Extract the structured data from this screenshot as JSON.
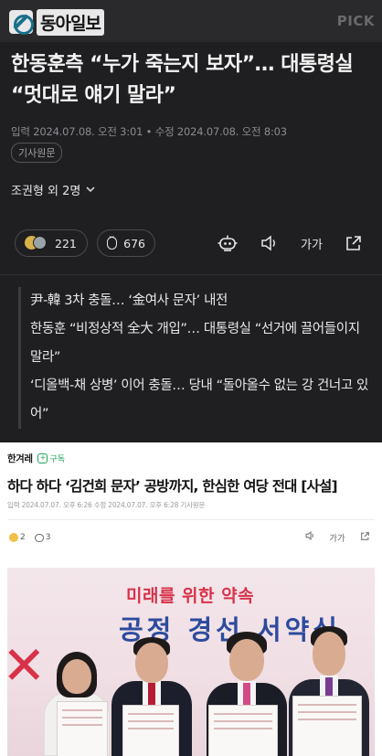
{
  "dark_card": {
    "logo_text": "동아일보",
    "pick_label": "PICK",
    "headline": "한동훈측 “누가 죽는지 보자”… 대통령실 “멋대로 얘기 말라”",
    "dateline": "입력 2024.07.08. 오전 3:01 • 수정 2024.07.08. 오전 8:03",
    "source_tag": "기사원문",
    "author": "조권형 외 2명",
    "likes_count": "221",
    "comments_count": "676",
    "font_size_label": "가가",
    "related": [
      "尹-韓 3차 충돌… ‘金여사 문자’ 내전",
      "한동훈 “비정상적 全大 개입”… 대통령실 “선거에 끌어들이지 말라”",
      "‘디올백-채 상병’ 이어 충돌… 당내 “돌아올수 없는 강 건너고 있어”"
    ]
  },
  "hankyoreh": {
    "brand": "한겨레",
    "subscribe_label": "구독",
    "title": "하다 하다 ‘김건희 문자’ 공방까지, 한심한 여당 전대 [사설]",
    "dateline": "입력 2024.07.07. 오후 6:26   수정 2024.07.07. 오후 6:28   기사원문",
    "reaction_count": "2",
    "comment_count": "3",
    "font_size_label": "가가",
    "photo": {
      "banner_top": "미래를 위한 약속",
      "banner_main_left": "공정 경선",
      "banner_main_right": "서약식"
    }
  }
}
